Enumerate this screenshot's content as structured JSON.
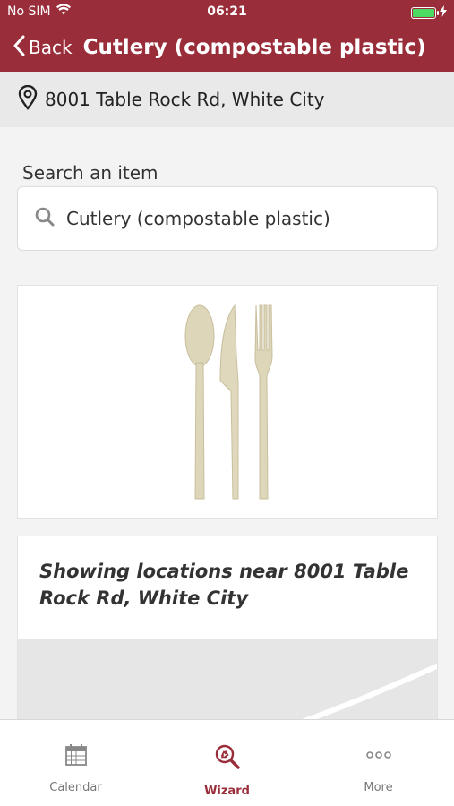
{
  "status": {
    "carrier": "No SIM",
    "time": "06:21"
  },
  "nav": {
    "back_label": "Back",
    "title": "Cutlery (compostable plastic)"
  },
  "address": {
    "text": "8001 Table Rock Rd, White City"
  },
  "search": {
    "label": "Search an item",
    "value": "Cutlery (compostable plastic)"
  },
  "item_image": {
    "icon": "cutlery-image"
  },
  "map": {
    "heading": "Showing locations near 8001 Table Rock Rd, White City"
  },
  "tabs": [
    {
      "label": "Calendar",
      "icon": "calendar-icon",
      "active": false
    },
    {
      "label": "Wizard",
      "icon": "recycle-search-icon",
      "active": true
    },
    {
      "label": "More",
      "icon": "more-icon",
      "active": false
    }
  ],
  "colors": {
    "brand": "#9a2d3a",
    "battery": "#4cd964"
  }
}
